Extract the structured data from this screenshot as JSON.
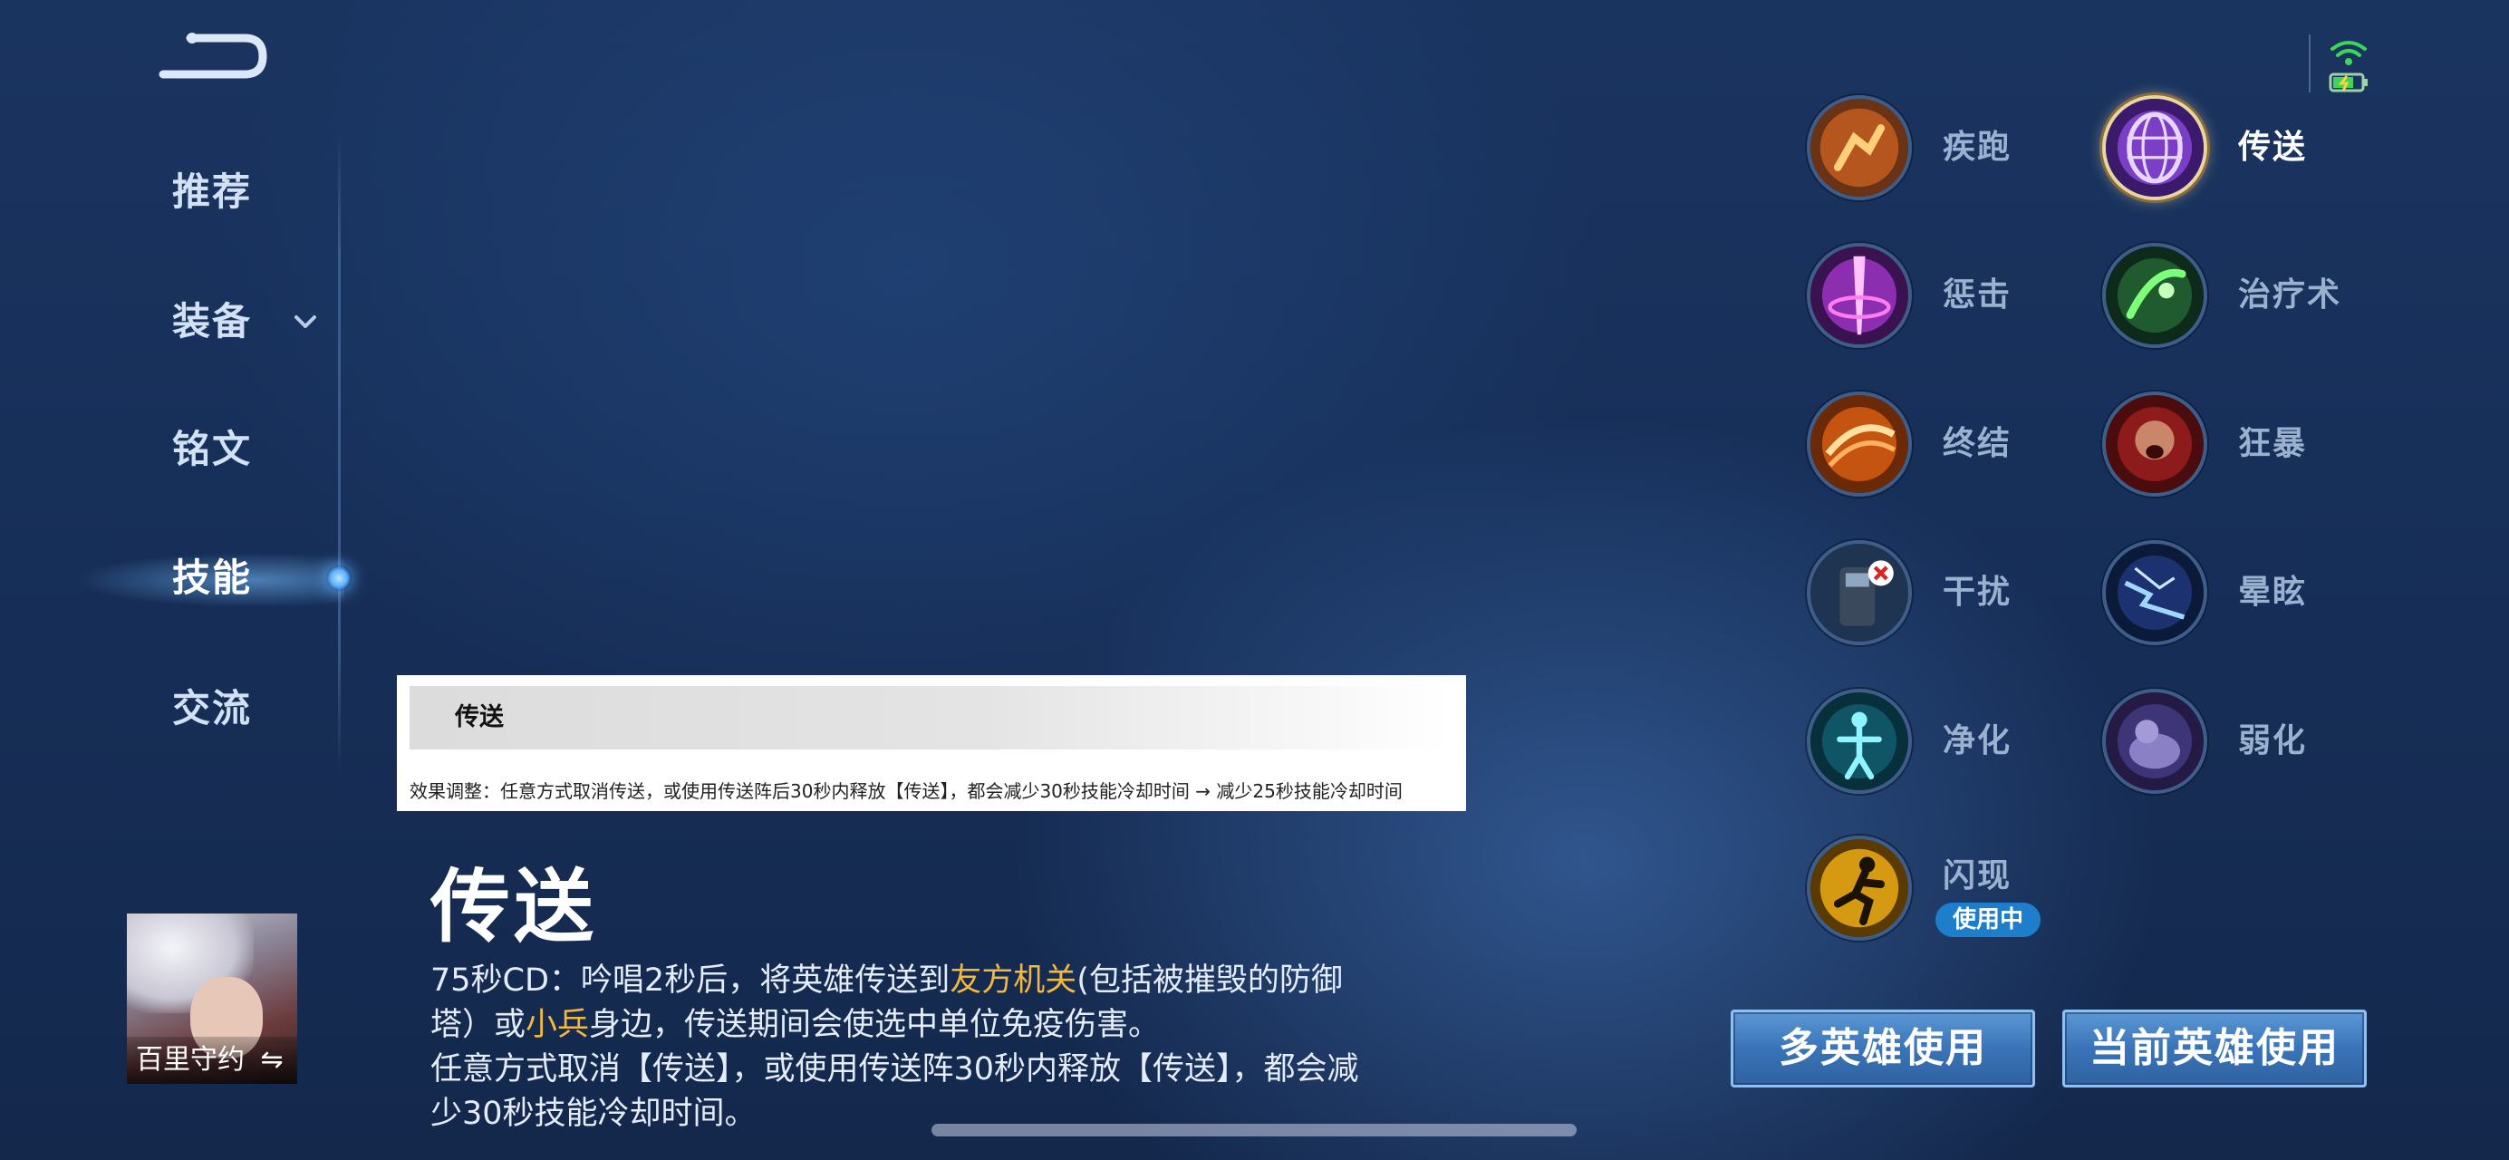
{
  "nav": {
    "items": [
      {
        "label": "推荐"
      },
      {
        "label": "装备"
      },
      {
        "label": "铭文"
      },
      {
        "label": "技能"
      },
      {
        "label": "交流"
      }
    ],
    "active": "技能"
  },
  "hero": {
    "name": "百里守约",
    "switch_icon": "⇋"
  },
  "tooltip": {
    "title": "传送",
    "desc": "效果调整：任意方式取消传送，或使用传送阵后30秒内释放【传送】，都会减少30秒技能冷却时间 → 减少25秒技能冷却时间"
  },
  "skill_detail": {
    "title": "传送",
    "desc_1a": "75秒CD：吟唱2秒后，将英雄传送到",
    "desc_1b": "友方机关",
    "desc_1c": "(包括被摧毁的防御塔）或",
    "desc_1d": "小兵",
    "desc_1e": "身边，传送期间会使选中单位免疫伤害。",
    "desc_2": "任意方式取消【传送】，或使用传送阵30秒内释放【传送】，都会减少30秒技能冷却时间。"
  },
  "skills": [
    {
      "name": "疾跑",
      "icon": "sprint-icon"
    },
    {
      "name": "传送",
      "icon": "teleport-icon",
      "selected": true
    },
    {
      "name": "惩击",
      "icon": "smite-icon"
    },
    {
      "name": "治疗术",
      "icon": "heal-icon"
    },
    {
      "name": "终结",
      "icon": "execute-icon"
    },
    {
      "name": "狂暴",
      "icon": "rage-icon"
    },
    {
      "name": "干扰",
      "icon": "disrupt-icon"
    },
    {
      "name": "晕眩",
      "icon": "stun-icon"
    },
    {
      "name": "净化",
      "icon": "purify-icon"
    },
    {
      "name": "弱化",
      "icon": "weaken-icon"
    },
    {
      "name": "闪现",
      "icon": "flash-icon",
      "badge": "使用中"
    }
  ],
  "buttons": {
    "multi": "多英雄使用",
    "current": "当前英雄使用"
  },
  "colors": {
    "highlight": "#f3b93d",
    "button": "#3a74b8",
    "badge": "#1f7ecb"
  }
}
